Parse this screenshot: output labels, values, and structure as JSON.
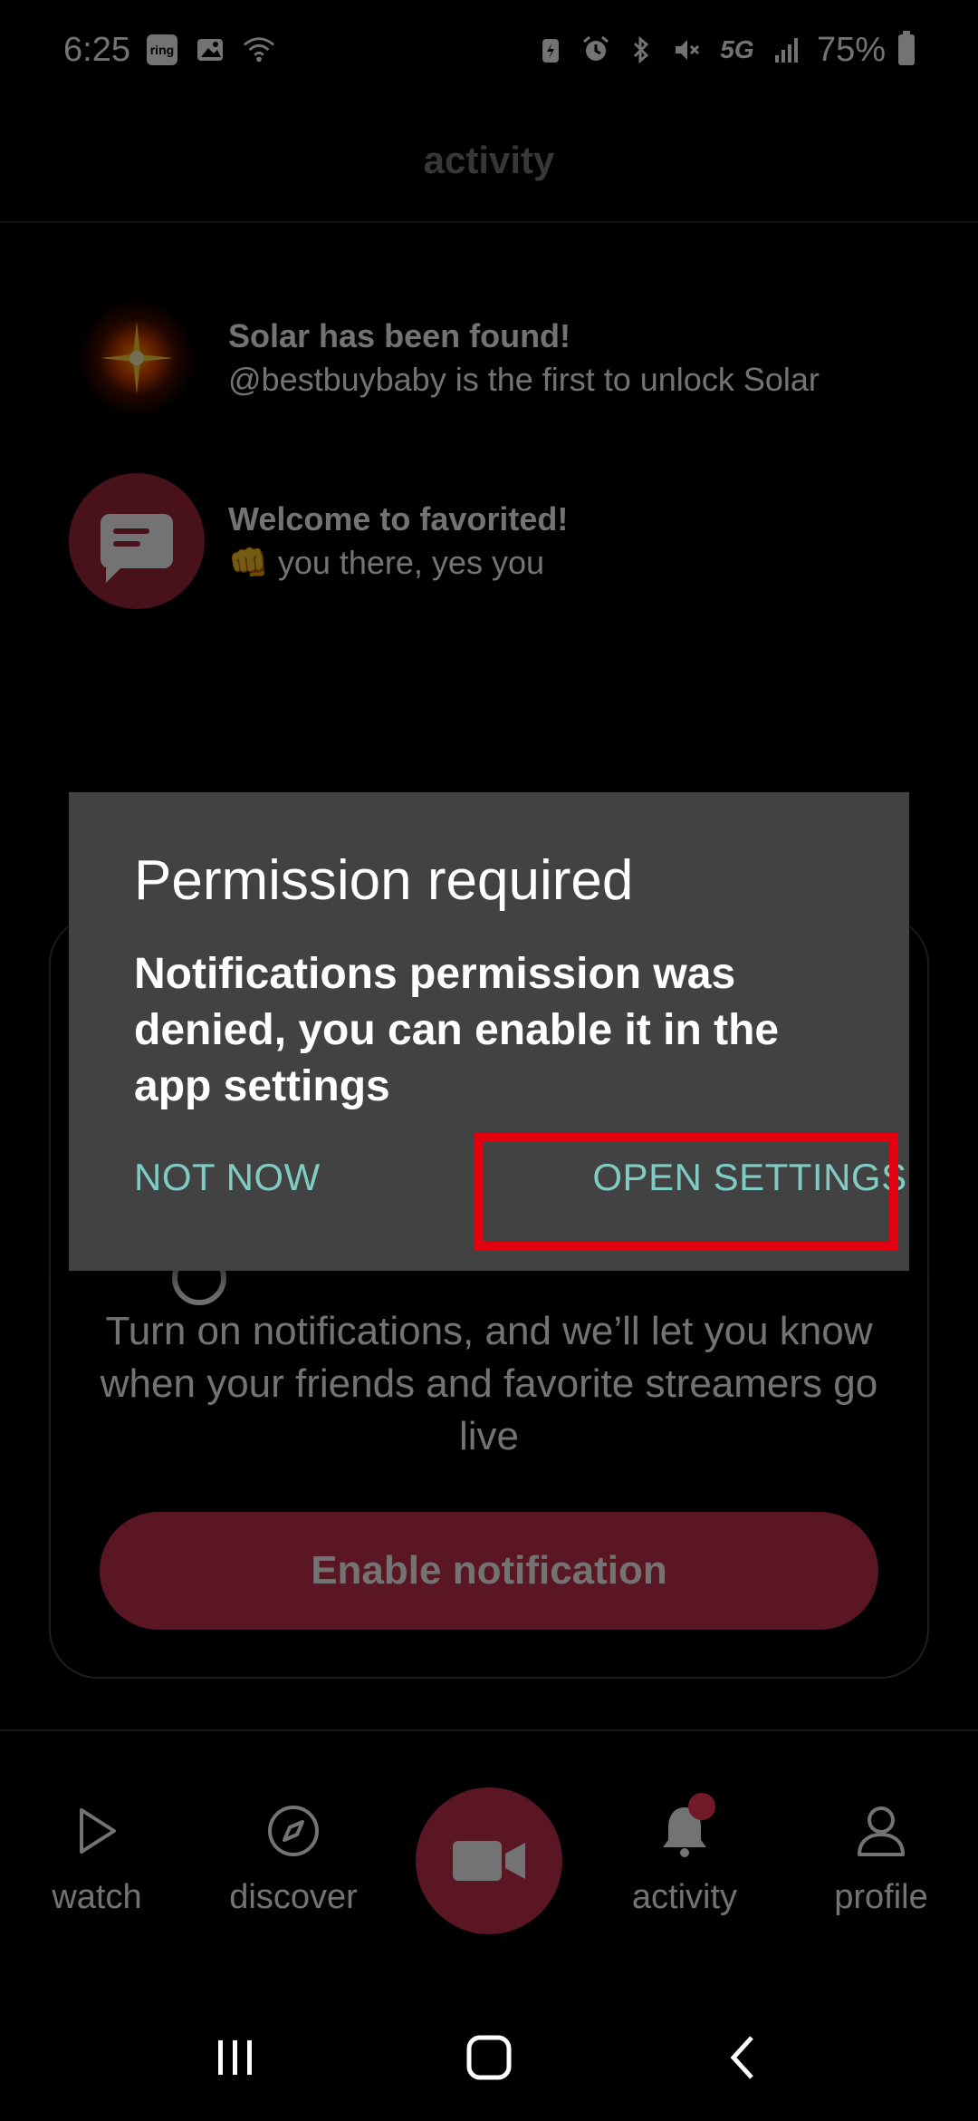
{
  "status_bar": {
    "time": "6:25",
    "ring_label": "ring",
    "battery_percent": "75%",
    "network": "5G",
    "icons": [
      "ring-icon",
      "image-icon",
      "wifi-icon",
      "battery-saver-icon",
      "alarm-icon",
      "bluetooth-icon",
      "mute-icon",
      "5g-icon",
      "signal-icon",
      "battery-icon"
    ]
  },
  "header": {
    "title": "activity"
  },
  "activity": {
    "items": [
      {
        "title": "Solar has been found!",
        "subtitle": "@bestbuybaby is the first to unlock Solar",
        "icon": "solar-sparkle-icon"
      },
      {
        "title": "Welcome to favorited!",
        "subtitle": "👊 you there, yes you",
        "icon": "chat-bubble-icon"
      }
    ]
  },
  "notification_card": {
    "description": "Turn on notifications, and we’ll let you know when your friends and favorite streamers go live",
    "button_label": "Enable notification"
  },
  "dialog": {
    "title": "Permission required",
    "message": "Notifications permission was denied, you can enable it in the app settings",
    "negative_label": "NOT NOW",
    "positive_label": "OPEN SETTINGS"
  },
  "bottom_nav": {
    "items": [
      {
        "label": "watch",
        "icon": "play-icon"
      },
      {
        "label": "discover",
        "icon": "compass-icon"
      },
      {
        "label": "",
        "icon": "video-camera-icon"
      },
      {
        "label": "activity",
        "icon": "bell-icon"
      },
      {
        "label": "profile",
        "icon": "person-icon"
      }
    ],
    "active": "activity"
  },
  "colors": {
    "accent": "#c8344f",
    "dialog_bg": "#424242",
    "dialog_button": "#80cbc4",
    "highlight": "#e3000f"
  }
}
